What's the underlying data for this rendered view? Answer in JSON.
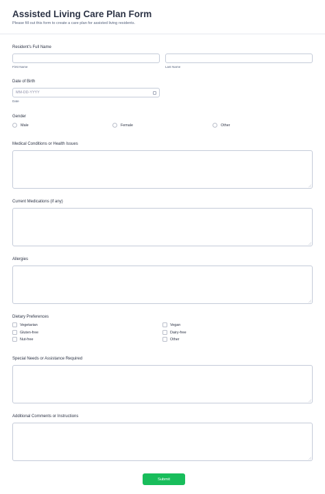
{
  "form": {
    "title": "Assisted Living Care Plan Form",
    "subtitle": "Please fill out this form to create a care plan for assisted living residents."
  },
  "name": {
    "label": "Resident's Full Name",
    "first_sublabel": "First Name",
    "last_sublabel": "Last Name"
  },
  "dob": {
    "label": "Date of Birth",
    "placeholder": "MM-DD-YYYY",
    "sublabel": "Date",
    "icon": "calendar-icon"
  },
  "gender": {
    "label": "Gender",
    "options": [
      "Male",
      "Female",
      "Other"
    ]
  },
  "medical": {
    "label": "Medical Conditions or Health Issues"
  },
  "medications": {
    "label": "Current Medications (if any)"
  },
  "allergies": {
    "label": "Allergies"
  },
  "dietary": {
    "label": "Dietary Preferences",
    "options": [
      "Vegetarian",
      "Vegan",
      "Gluten-free",
      "Dairy-free",
      "Nut-free",
      "Other"
    ]
  },
  "special_needs": {
    "label": "Special Needs or Assistance Required"
  },
  "comments": {
    "label": "Additional Comments or Instructions"
  },
  "submit": {
    "label": "Submit",
    "color": "#18bd5b"
  }
}
